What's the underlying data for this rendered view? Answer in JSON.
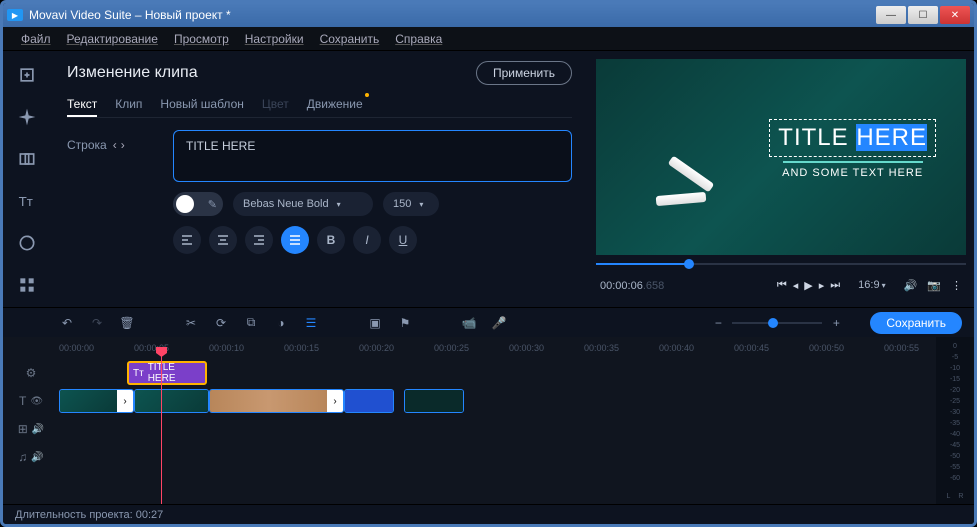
{
  "window": {
    "title": "Movavi Video Suite – Новый проект *"
  },
  "menu": {
    "file": "Файл",
    "edit": "Редактирование",
    "view": "Просмотр",
    "settings": "Настройки",
    "save": "Сохранить",
    "help": "Справка"
  },
  "editor": {
    "title": "Изменение клипа",
    "apply": "Применить",
    "tabs": {
      "text": "Текст",
      "clip": "Клип",
      "template": "Новый шаблон",
      "color": "Цвет",
      "motion": "Движение"
    },
    "row_label": "Строка",
    "text_value": "TITLE HERE",
    "font": "Bebas Neue Bold",
    "size": "150",
    "align": {
      "left": "≡",
      "center": "≡",
      "right": "≡",
      "justify": "≡"
    },
    "style": {
      "bold": "B",
      "italic": "I",
      "underline": "U"
    }
  },
  "preview": {
    "title_pre": "TITLE ",
    "title_hl": "HERE",
    "subtitle": "AND SOME TEXT HERE",
    "time": "00:00:06",
    "ms": ".658",
    "aspect": "16:9"
  },
  "toolbar": {
    "save": "Сохранить"
  },
  "ruler": {
    "marks": [
      "00:00:00",
      "00:00:05",
      "00:00:10",
      "00:00:15",
      "00:00:20",
      "00:00:25",
      "00:00:30",
      "00:00:35",
      "00:00:40",
      "00:00:45",
      "00:00:50",
      "00:00:55"
    ]
  },
  "track_title_clip": "TITLE HERE",
  "meters": {
    "db": [
      "0",
      "-5",
      "-10",
      "-15",
      "-20",
      "-25",
      "-30",
      "-35",
      "-40",
      "-45",
      "-50",
      "-55",
      "-60"
    ],
    "l": "L",
    "r": "R"
  },
  "status": {
    "duration_label": "Длительность проекта:",
    "duration": "00:27"
  }
}
